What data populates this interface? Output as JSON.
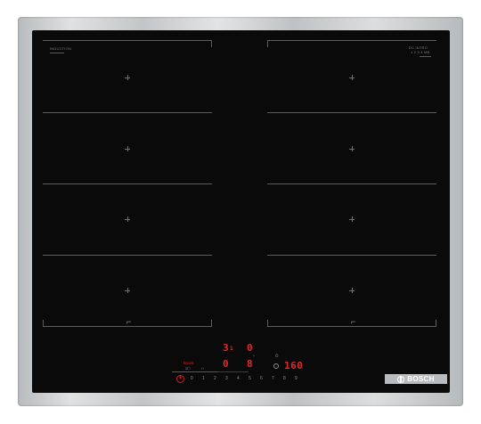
{
  "cooktop": {
    "zone_left_label": "INDUCTION",
    "zone_right_label": "DC INTRO",
    "zone_right_sub": "1 2 3 4 MB",
    "displays": {
      "top_a": "3",
      "top_a_small": "1",
      "top_b": "0",
      "bottom_a": "0",
      "bottom_b": "8",
      "timer": "160"
    },
    "small_labels": {
      "boost": "Boost",
      "boost_sub": "≡□",
      "left_mode": "‹‹",
      "heat_label": "°",
      "timer_small": "⏱"
    },
    "slider_digits": [
      "0",
      "1",
      "2",
      "3",
      "4",
      "5",
      "6",
      "7",
      "8",
      "9"
    ],
    "brand": "BOSCH",
    "accent_color": "#e3282c"
  }
}
